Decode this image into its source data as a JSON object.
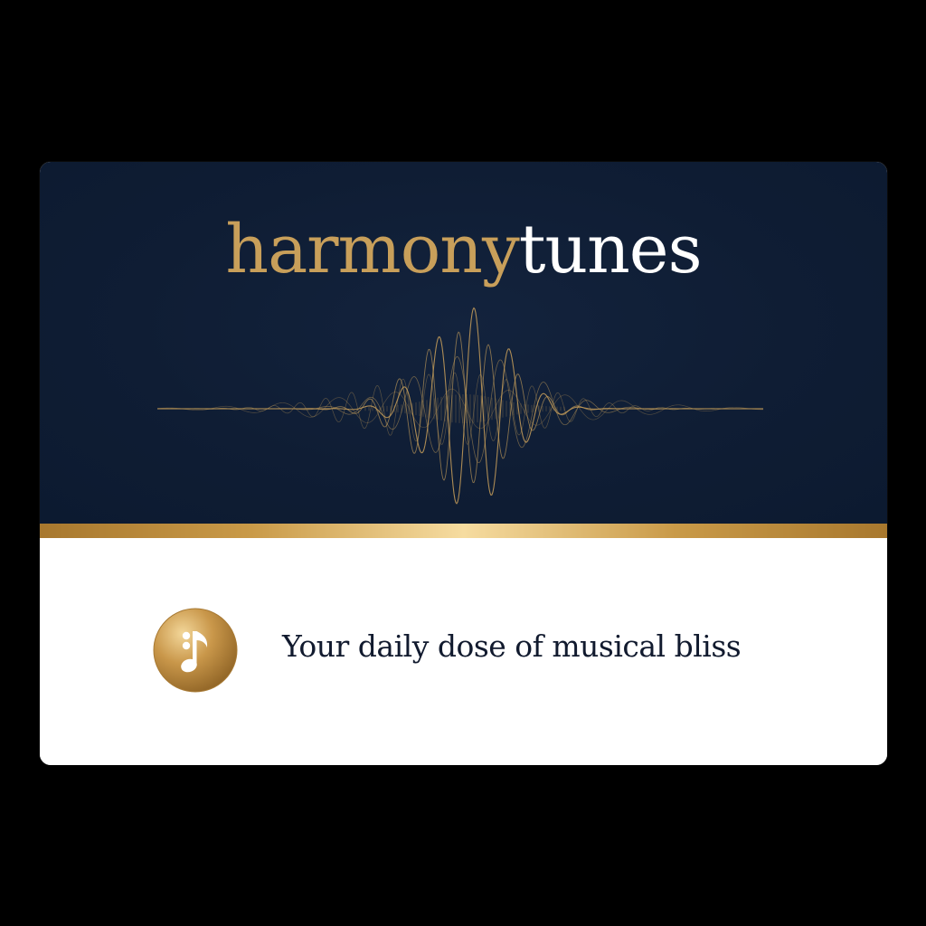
{
  "brand": {
    "name_part1": "harmony",
    "name_part2": "tunes",
    "tagline": "Your daily dose of musical bliss"
  },
  "icons": {
    "waveform": "waveform-icon",
    "badge": "music-note-icon"
  },
  "colors": {
    "background": "#000000",
    "navy": "#0f1d34",
    "gold": "#c89f5a",
    "white": "#ffffff",
    "tagline_text": "#111a2e"
  }
}
